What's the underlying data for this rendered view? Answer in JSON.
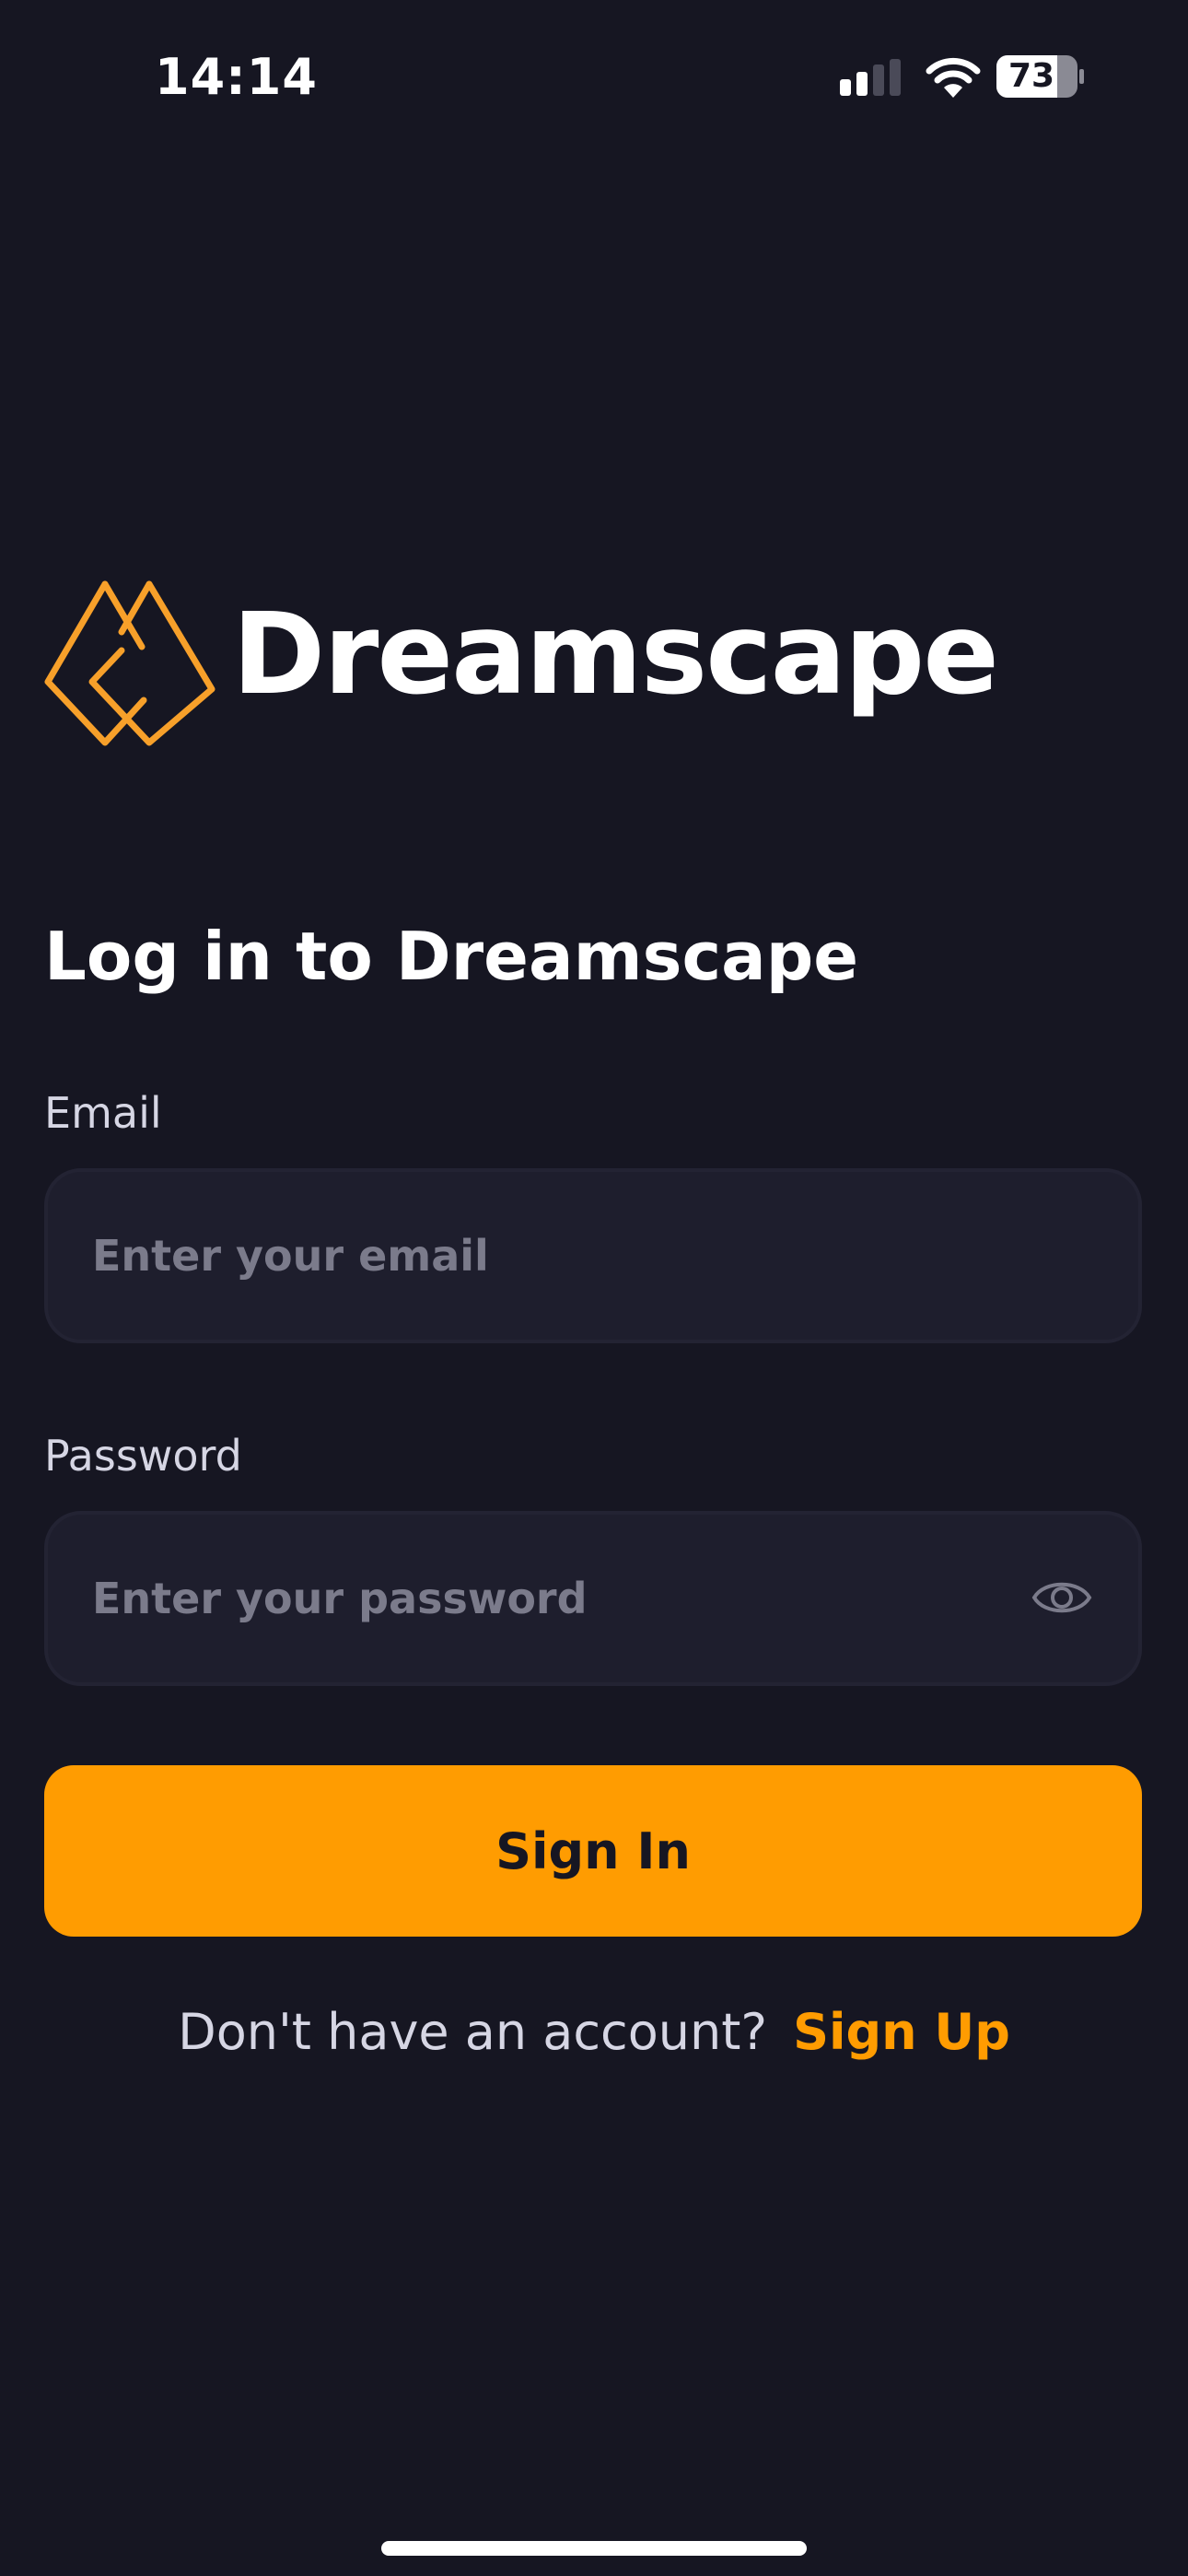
{
  "status_bar": {
    "time": "14:14",
    "battery_level": "73",
    "icons": [
      "signal-icon",
      "wifi-icon",
      "battery-icon"
    ]
  },
  "logo": {
    "text": "Dreamscape",
    "icon": "dreamscape-logo-icon",
    "accent_color": "#ff9c01"
  },
  "form": {
    "heading": "Log in to Dreamscape",
    "email": {
      "label": "Email",
      "placeholder": "Enter your email",
      "value": ""
    },
    "password": {
      "label": "Password",
      "placeholder": "Enter your password",
      "value": "",
      "toggle_icon": "eye-icon"
    },
    "submit_label": "Sign In"
  },
  "signup": {
    "prompt": "Don't have an account?",
    "link_label": "Sign Up"
  },
  "colors": {
    "background": "#161622",
    "input_background": "#1e1e2d",
    "accent": "#ff9c01",
    "text_primary": "#ffffff",
    "text_secondary": "#d6d6e4",
    "placeholder": "#7b7b8b"
  }
}
